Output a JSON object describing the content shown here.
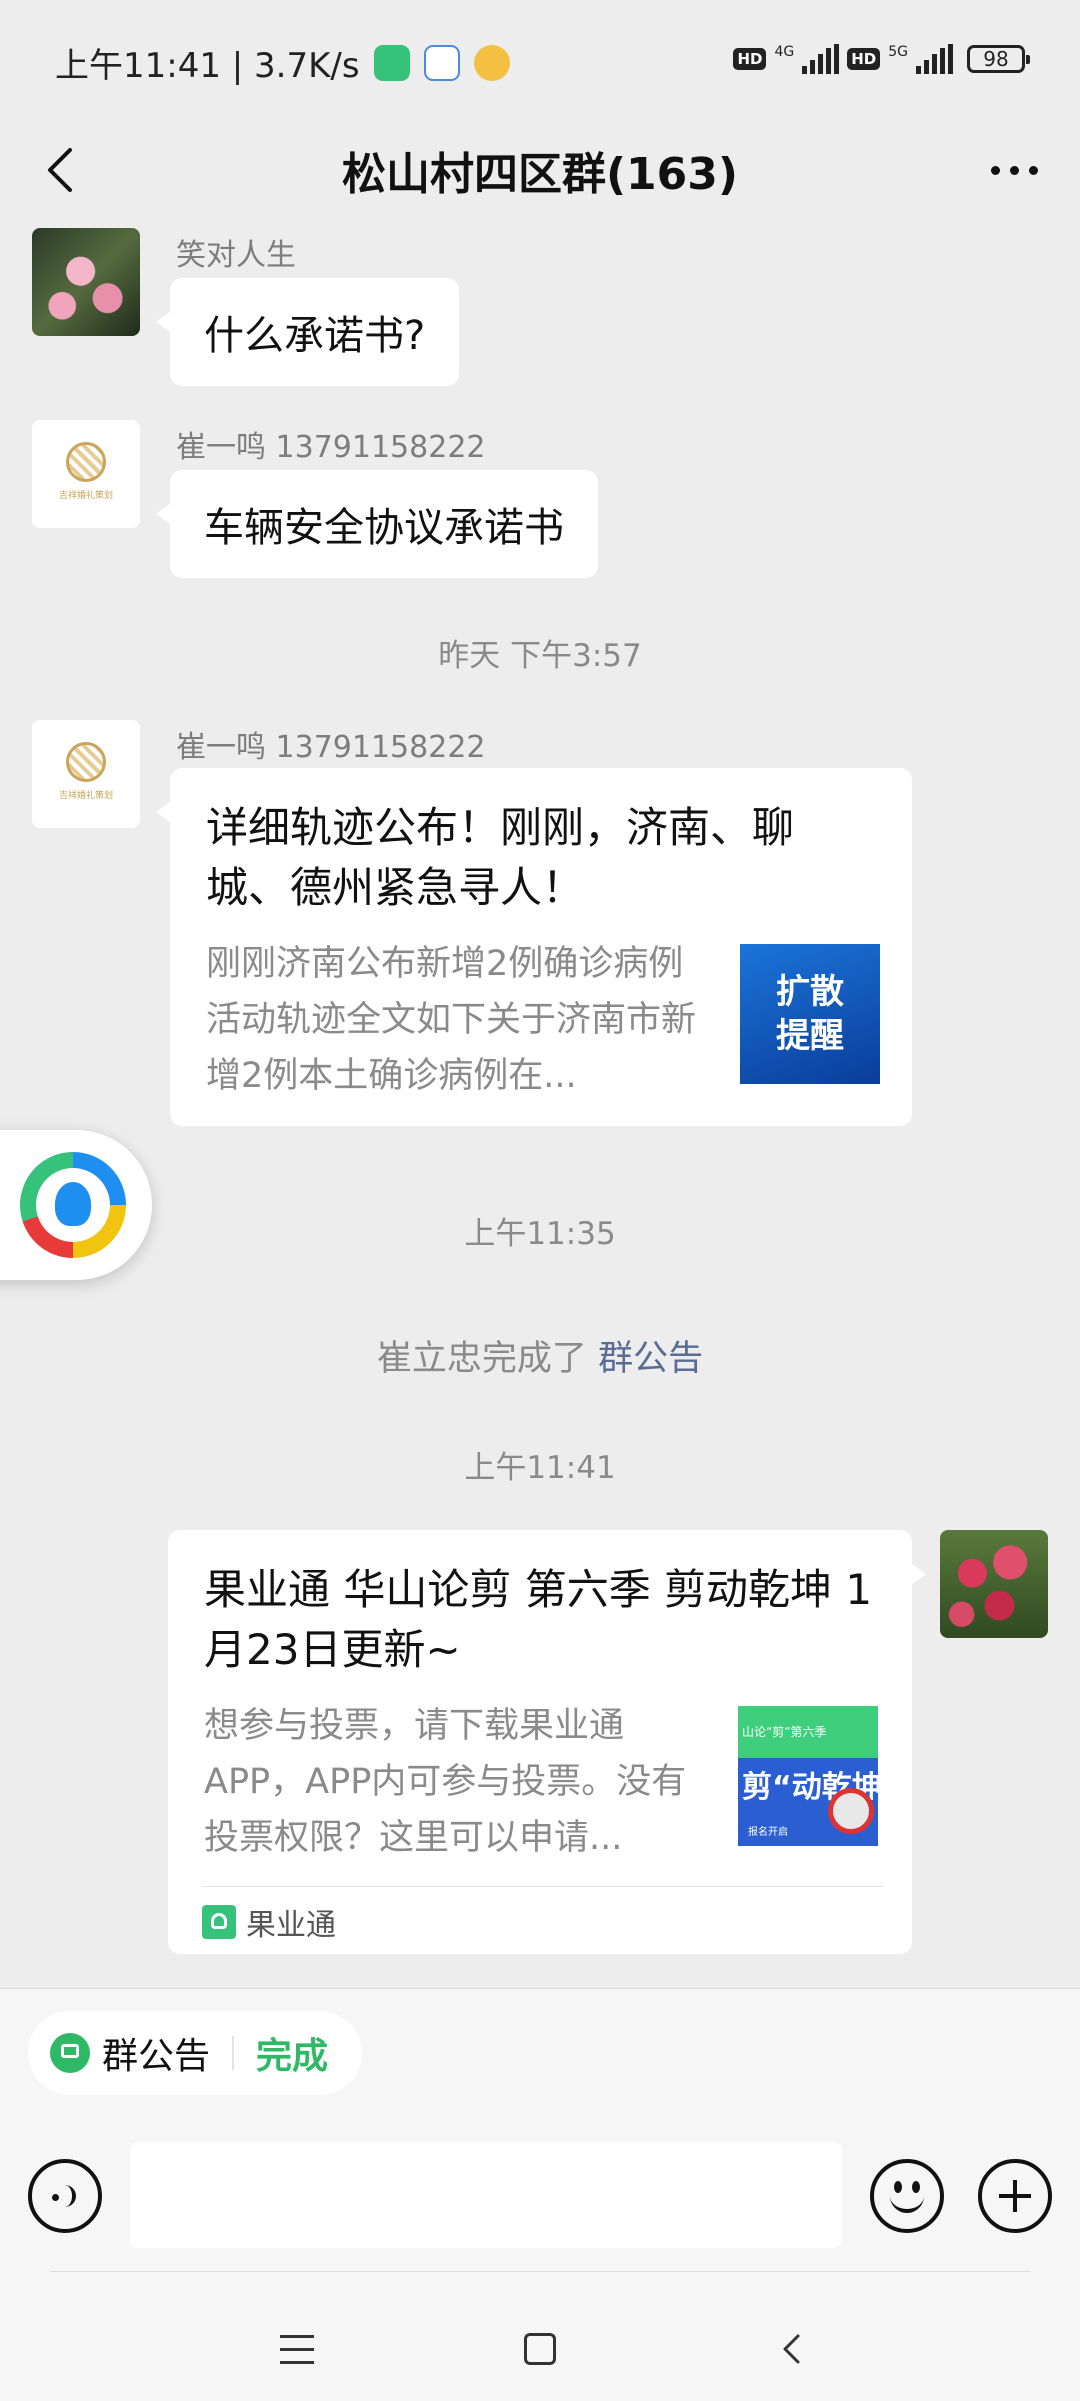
{
  "status_bar": {
    "time_speed": "上午11:41 | 3.7K/s",
    "hd1": "HD",
    "net1": "4G",
    "hd2": "HD",
    "net2": "5G",
    "battery": "98"
  },
  "header": {
    "title": "松山村四区群(163)"
  },
  "messages": [
    {
      "sender": "笑对人生",
      "text": "什么承诺书?",
      "avatar": "flower-avatar"
    },
    {
      "sender": "崔一鸣 13791158222",
      "text": "车辆安全协议承诺书",
      "avatar": "logo-avatar",
      "avatar_caption": "吉祥婚礼策划"
    },
    {
      "sender": "崔一鸣 13791158222",
      "avatar": "logo-avatar",
      "avatar_caption": "吉祥婚礼策划",
      "card": {
        "title": "详细轨迹公布！刚刚，济南、聊城、德州紧急寻人！",
        "desc": "刚刚济南公布新增2例确诊病例活动轨迹全文如下关于济南市新增2例本土确诊病例在...",
        "thumb_line1": "扩散",
        "thumb_line2": "提醒"
      }
    },
    {
      "avatar": "apple-avatar",
      "card": {
        "title": "果业通 华山论剪 第六季 剪动乾坤 1月23日更新~",
        "desc": "想参与投票，请下载果业通APP，APP内可参与投票。没有投票权限？这里可以申请...",
        "thumb_top": "山论“剪”第六季",
        "thumb_big": "剪“动乾坤",
        "thumb_small": "报名开启",
        "source": "果业通"
      }
    }
  ],
  "timestamps": {
    "t1": "昨天 下午3:57",
    "t2": "上午11:35",
    "t3": "上午11:41"
  },
  "system_message": {
    "prefix": "崔立忠完成了 ",
    "link": "群公告"
  },
  "bottom": {
    "notice_label": "群公告",
    "notice_done": "完成"
  },
  "colors": {
    "accent_green": "#2fb866",
    "link_blue": "#586c94",
    "chat_bg": "#ededed"
  }
}
